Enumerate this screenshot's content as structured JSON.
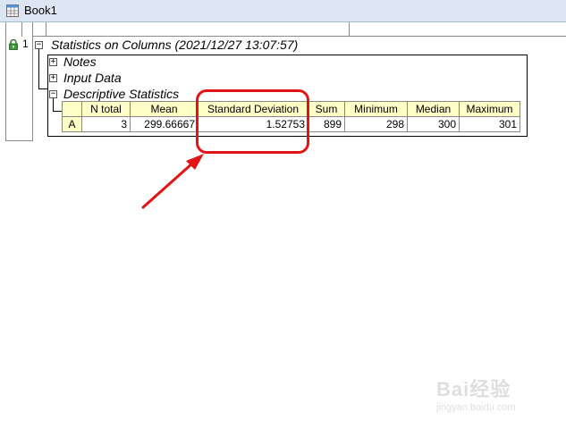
{
  "window": {
    "title": "Book1"
  },
  "sheet": {
    "row_number": "1",
    "section_title": "Statistics on Columns (2021/12/27 13:07:57)",
    "tree": {
      "notes": "Notes",
      "input_data": "Input Data",
      "descriptive_statistics": "Descriptive Statistics"
    }
  },
  "table": {
    "headers": [
      "N total",
      "Mean",
      "Standard Deviation",
      "Sum",
      "Minimum",
      "Median",
      "Maximum"
    ],
    "rows": [
      {
        "label": "A",
        "values": [
          "3",
          "299.66667",
          "1.52753",
          "899",
          "298",
          "300",
          "301"
        ]
      }
    ]
  },
  "annotation": {
    "highlight_color": "#e21414"
  },
  "watermark": {
    "brand": "Bai经验",
    "url": "jingyan.baidu.com"
  },
  "colors": {
    "header_bg": "#ffffc8",
    "titlebar_bg": "#dce6f2"
  }
}
